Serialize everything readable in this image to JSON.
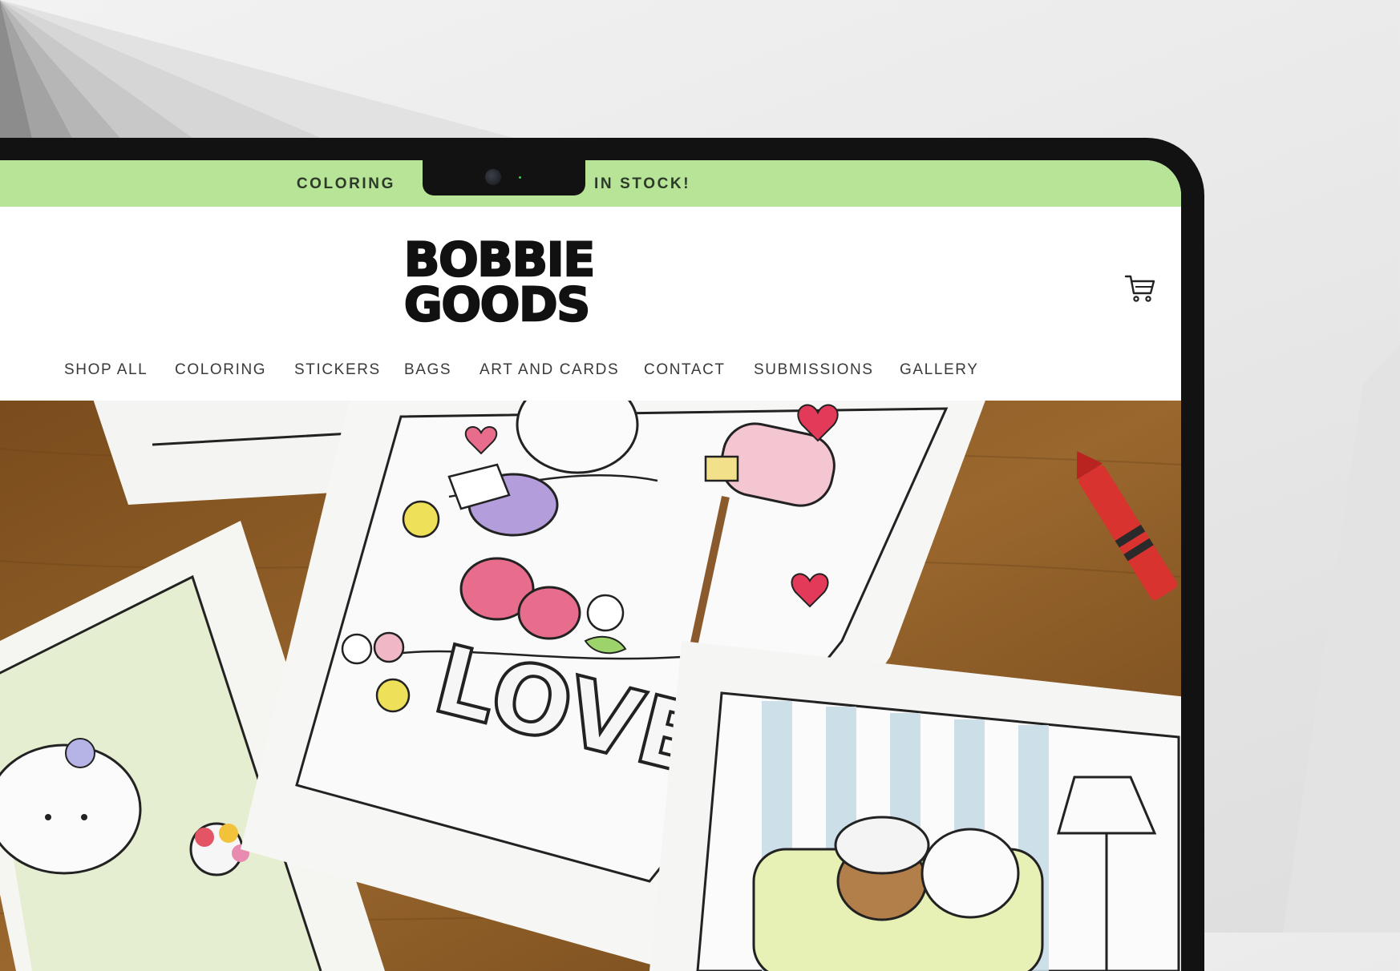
{
  "announcement": {
    "left_text": "COLORING",
    "right_text": "IN STOCK!"
  },
  "brand": {
    "line1": "BOBBIE",
    "line2": "GOODS"
  },
  "nav": {
    "items": [
      "SHOP ALL",
      "COLORING",
      "STICKERS",
      "BAGS",
      "ART AND CARDS",
      "CONTACT",
      "SUBMISSIONS",
      "GALLERY"
    ]
  },
  "hero": {
    "word": "LOVE"
  },
  "icons": {
    "cart": "cart-icon"
  },
  "colors": {
    "announcement_bg": "#b7e497",
    "device_frame": "#121212",
    "table_wood": "#8a5a23"
  }
}
